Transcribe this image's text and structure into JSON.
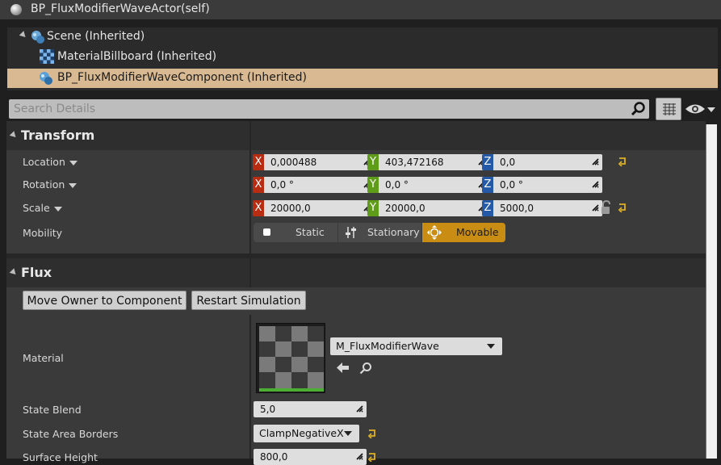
{
  "actor": {
    "title": "BP_FluxModifierWaveActor(self)"
  },
  "tree": [
    {
      "label": "Scene (Inherited)",
      "icon": "scene-component-icon"
    },
    {
      "label": "MaterialBillboard (Inherited)",
      "icon": "checker-material-icon"
    },
    {
      "label": "BP_FluxModifierWaveComponent (Inherited)",
      "icon": "component-icon",
      "selected": true
    }
  ],
  "search": {
    "placeholder": "Search Details"
  },
  "transform": {
    "title": "Transform",
    "location": {
      "label": "Location",
      "x": "0,000488",
      "y": "403,472168",
      "z": "0,0"
    },
    "rotation": {
      "label": "Rotation",
      "x": "0,0 °",
      "y": "0,0 °",
      "z": "0,0 °"
    },
    "scale": {
      "label": "Scale",
      "x": "20000,0",
      "y": "20000,0",
      "z": "5000,0"
    },
    "axis_letters": {
      "x": "X",
      "y": "Y",
      "z": "Z"
    },
    "mobility": {
      "label": "Mobility",
      "options": [
        "Static",
        "Stationary",
        "Movable"
      ],
      "selected": "Movable"
    }
  },
  "flux": {
    "title": "Flux",
    "buttons": {
      "move_owner": "Move Owner to Component",
      "restart": "Restart Simulation"
    },
    "material": {
      "label": "Material",
      "value": "M_FluxModifierWave"
    },
    "state_blend": {
      "label": "State Blend",
      "value": "5,0"
    },
    "state_area_borders": {
      "label": "State Area Borders",
      "value": "ClampNegativeX"
    },
    "surface_height": {
      "label": "Surface Height",
      "value": "800,0"
    }
  },
  "colors": {
    "selection": "#d9b991",
    "movable": "#c98d14",
    "axis_x": "#b82c12",
    "axis_y": "#5e9c1a",
    "axis_z": "#2459a8",
    "reset": "#e0b020"
  }
}
